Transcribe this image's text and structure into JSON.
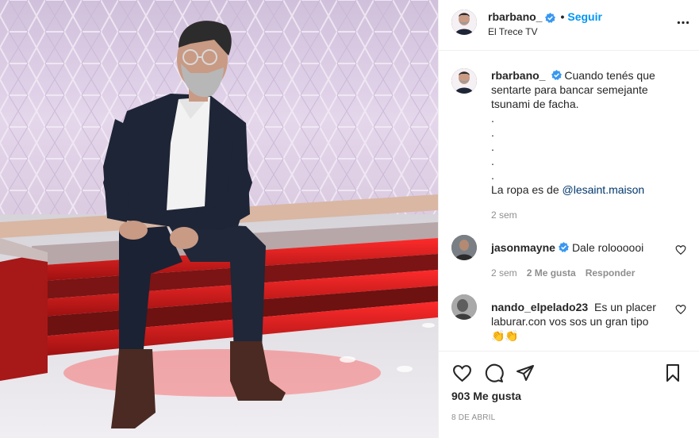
{
  "post": {
    "author": "rbarbano_",
    "follow_label": "Seguir",
    "location": "El Trece TV",
    "caption_lines": [
      "Cuando tenés que",
      "sentarte para bancar semejante",
      "tsunami de facha.",
      ".",
      ".",
      ".",
      ".",
      "."
    ],
    "caption_last_prefix": "La ropa es de ",
    "caption_mention": "@lesaint.maison",
    "caption_time": "2 sem",
    "likes": "903 Me gusta",
    "date": "8 DE ABRIL"
  },
  "comments": [
    {
      "user": "jasonmayne",
      "text": "Dale roloooooi",
      "time": "2 sem",
      "likes": "2 Me gusta",
      "reply": "Responder"
    },
    {
      "user": "nando_elpelado23",
      "text_line1": "Es un placer",
      "text_line2": "laburar.con vos sos un gran tipo",
      "emoji": "👏👏"
    }
  ],
  "icons": {
    "more": "more-options-icon",
    "like": "heart-icon",
    "comment": "comment-icon",
    "share": "share-icon",
    "save": "bookmark-icon",
    "verified": "verified-badge-icon"
  },
  "colors": {
    "accent": "#0095f6",
    "verified": "#3897f0",
    "mention": "#00376b",
    "muted": "#8e8e8e",
    "stage_red": "#e0191e"
  }
}
